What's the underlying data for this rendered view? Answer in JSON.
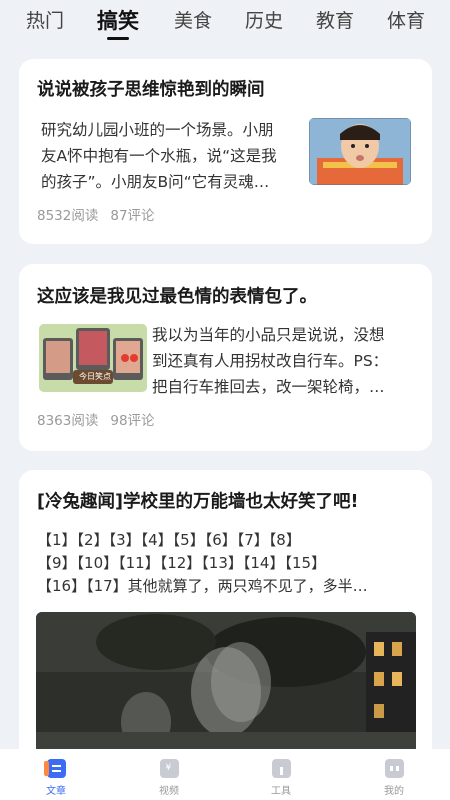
{
  "tabs": [
    {
      "label": "热门"
    },
    {
      "label": "搞笑"
    },
    {
      "label": "美食"
    },
    {
      "label": "历史"
    },
    {
      "label": "教育"
    },
    {
      "label": "体育"
    }
  ],
  "active_tab": "搞笑",
  "articles": [
    {
      "title": "说说被孩子思维惊艳到的瞬间",
      "excerpt_lines": [
        "研究幼儿园小班的一个场景。小朋",
        "友A怀中抱有一个水瓶，说“这是我",
        "的孩子”。小朋友B问“它有灵魂…"
      ],
      "reads": "8532阅读",
      "comments": "87评论",
      "thumbnail_icon": "child-photo"
    },
    {
      "title": "这应该是我见过最色情的表情包了。",
      "excerpt_lines": [
        "我以为当年的小品只是说说，没想",
        "到还真有人用拐杖改自行车。PS：",
        "把自行车推回去，改一架轮椅，…"
      ],
      "reads": "8363阅读",
      "comments": "98评论",
      "thumbnail_icon": "meme-tv-photo",
      "thumbnail_caption": "今日笑点"
    },
    {
      "title": "[冷兔趣闻]学校里的万能墙也太好笑了吧!",
      "body_lines": [
        "【1】【2】【3】【4】【5】【6】【7】【8】",
        "【9】【10】【11】【12】【13】【14】【15】",
        "【16】【17】其他就算了，两只鸡不见了，多半…"
      ],
      "image_icon": "night-scene-photo"
    }
  ],
  "bottom_nav": [
    {
      "label": "文章",
      "icon": "article-icon",
      "active": true
    },
    {
      "label": "视频",
      "icon": "video-icon",
      "active": false
    },
    {
      "label": "工具",
      "icon": "tool-icon",
      "active": false
    },
    {
      "label": "我的",
      "icon": "profile-icon",
      "active": false
    }
  ],
  "colors": {
    "accent": "#3b6cf6",
    "background": "#eef1f5",
    "card": "#ffffff"
  }
}
